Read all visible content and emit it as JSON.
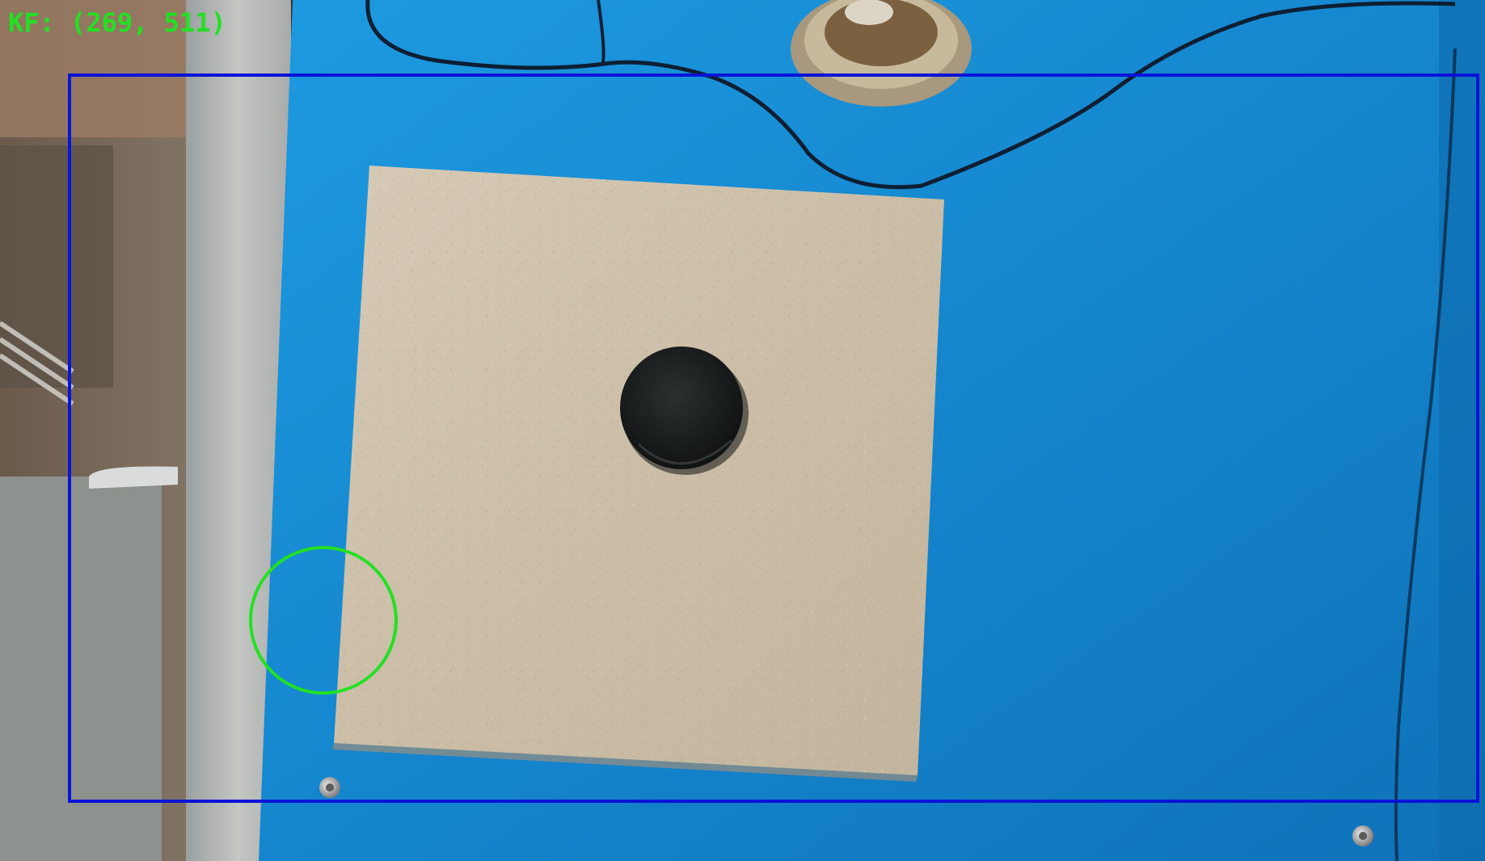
{
  "overlay": {
    "keyframe_label": "KF: (269, 511)",
    "label_color": "#22e022",
    "box_color": "#0a14d8",
    "marker_color": "#22e022"
  },
  "scene": {
    "objects": [
      {
        "name": "blue-platform",
        "color": "#1a8fd6"
      },
      {
        "name": "tile-plate",
        "color": "#cdbfa9"
      },
      {
        "name": "black-puck",
        "color": "#1c1f1f"
      },
      {
        "name": "cable",
        "color": "#0e1f33"
      },
      {
        "name": "metal-fixture",
        "color": "#b7a98c"
      },
      {
        "name": "screw-heads",
        "color": "#c8c8c8"
      }
    ]
  }
}
